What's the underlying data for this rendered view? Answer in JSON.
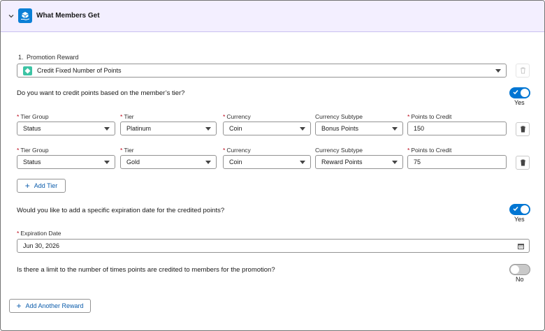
{
  "header": {
    "title": "What Members Get",
    "icon": "box-hand-icon"
  },
  "reward": {
    "number": "1.",
    "label": "Promotion Reward",
    "value": "Credit Fixed Number of Points"
  },
  "tier_question": {
    "text": "Do you want to credit points based on the member’s tier?",
    "toggle_state": "Yes"
  },
  "columns": {
    "tier_group": "Tier Group",
    "tier": "Tier",
    "currency": "Currency",
    "currency_subtype": "Currency Subtype",
    "points": "Points to Credit",
    "required_mark": "*"
  },
  "rows": [
    {
      "tier_group": "Status",
      "tier": "Platinum",
      "currency": "Coin",
      "currency_subtype": "Bonus Points",
      "points": "150"
    },
    {
      "tier_group": "Status",
      "tier": "Gold",
      "currency": "Coin",
      "currency_subtype": "Reward Points",
      "points": "75"
    }
  ],
  "add_tier_label": "Add Tier",
  "expiration_question": {
    "text": "Would you like to add a specific expiration date for the credited points?",
    "toggle_state": "Yes"
  },
  "expiration": {
    "label": "Expiration Date",
    "value": "Jun 30, 2026"
  },
  "limit_question": {
    "text": "Is there a limit to the number of times points are credited to members for the promotion?",
    "toggle_state": "No"
  },
  "add_reward_label": "Add Another Reward",
  "colors": {
    "accent": "#0176d3",
    "header_bg": "#f3efff",
    "required": "#ba0517",
    "reward_icon": "#3cc3a4"
  }
}
